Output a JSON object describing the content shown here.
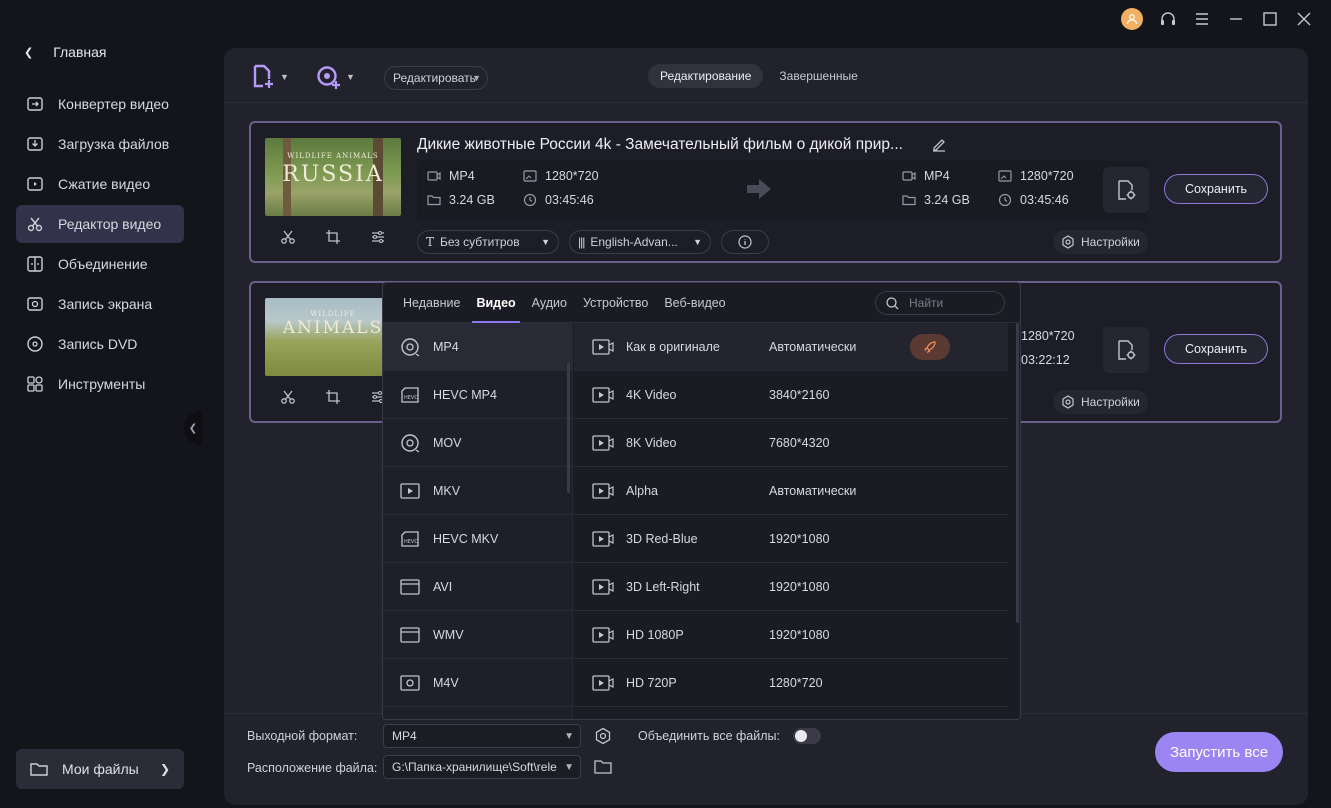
{
  "sidebar": {
    "back_label": "Главная",
    "items": [
      {
        "label": "Конвертер видео",
        "icon": "converter-icon"
      },
      {
        "label": "Загрузка файлов",
        "icon": "download-icon"
      },
      {
        "label": "Сжатие видео",
        "icon": "compress-icon"
      },
      {
        "label": "Редактор видео",
        "icon": "scissors-icon"
      },
      {
        "label": "Объединение",
        "icon": "merge-icon"
      },
      {
        "label": "Запись экрана",
        "icon": "screen-record-icon"
      },
      {
        "label": "Запись DVD",
        "icon": "dvd-icon"
      },
      {
        "label": "Инструменты",
        "icon": "tools-icon"
      }
    ],
    "my_files": "Мои файлы"
  },
  "toolbar": {
    "edit_select": "Редактировать",
    "tabs": [
      "Редактирование",
      "Завершенные"
    ]
  },
  "cards": [
    {
      "thumb_title": "RUSSIA",
      "thumb_subtitle": "WILDLIFE ANIMALS",
      "title": "Дикие животные России 4k - Замечательный фильм о дикой прир...",
      "src": {
        "format": "MP4",
        "size": "3.24 GB",
        "res": "1280*720",
        "duration": "03:45:46"
      },
      "dst": {
        "format": "MP4",
        "size": "3.24 GB",
        "res": "1280*720",
        "duration": "03:45:46"
      },
      "subtitle_pill": "Без субтитров",
      "audio_pill": "English-Advan...",
      "save": "Сохранить",
      "settings": "Настройки"
    },
    {
      "thumb_title": "ANIMALS",
      "thumb_subtitle": "WILDLIFE",
      "dst": {
        "res": "1280*720",
        "duration": "03:22:12"
      },
      "save": "Сохранить",
      "settings": "Настройки"
    }
  ],
  "popup": {
    "tabs": [
      "Недавние",
      "Видео",
      "Аудио",
      "Устройство",
      "Веб-видео"
    ],
    "active_tab": "Видео",
    "search_placeholder": "Найти",
    "formats": [
      "MP4",
      "HEVC MP4",
      "MOV",
      "MKV",
      "HEVC MKV",
      "AVI",
      "WMV",
      "M4V"
    ],
    "presets": [
      {
        "name": "Как в оригинале",
        "res": "Автоматически"
      },
      {
        "name": "4K Video",
        "res": "3840*2160"
      },
      {
        "name": "8K Video",
        "res": "7680*4320"
      },
      {
        "name": "Alpha",
        "res": "Автоматически"
      },
      {
        "name": "3D Red-Blue",
        "res": "1920*1080"
      },
      {
        "name": "3D Left-Right",
        "res": "1920*1080"
      },
      {
        "name": "HD 1080P",
        "res": "1920*1080"
      },
      {
        "name": "HD 720P",
        "res": "1280*720"
      }
    ]
  },
  "bottom": {
    "output_label": "Выходной формат:",
    "output_value": "MP4",
    "merge_label": "Объединить все файлы:",
    "location_label": "Расположение файла:",
    "location_value": "G:\\Папка-хранилище\\Soft\\rele",
    "run_all": "Запустить все"
  },
  "colors": {
    "accent": "#9b85f2",
    "card_border": "#6a6090",
    "rocket": "#f08a5c"
  }
}
